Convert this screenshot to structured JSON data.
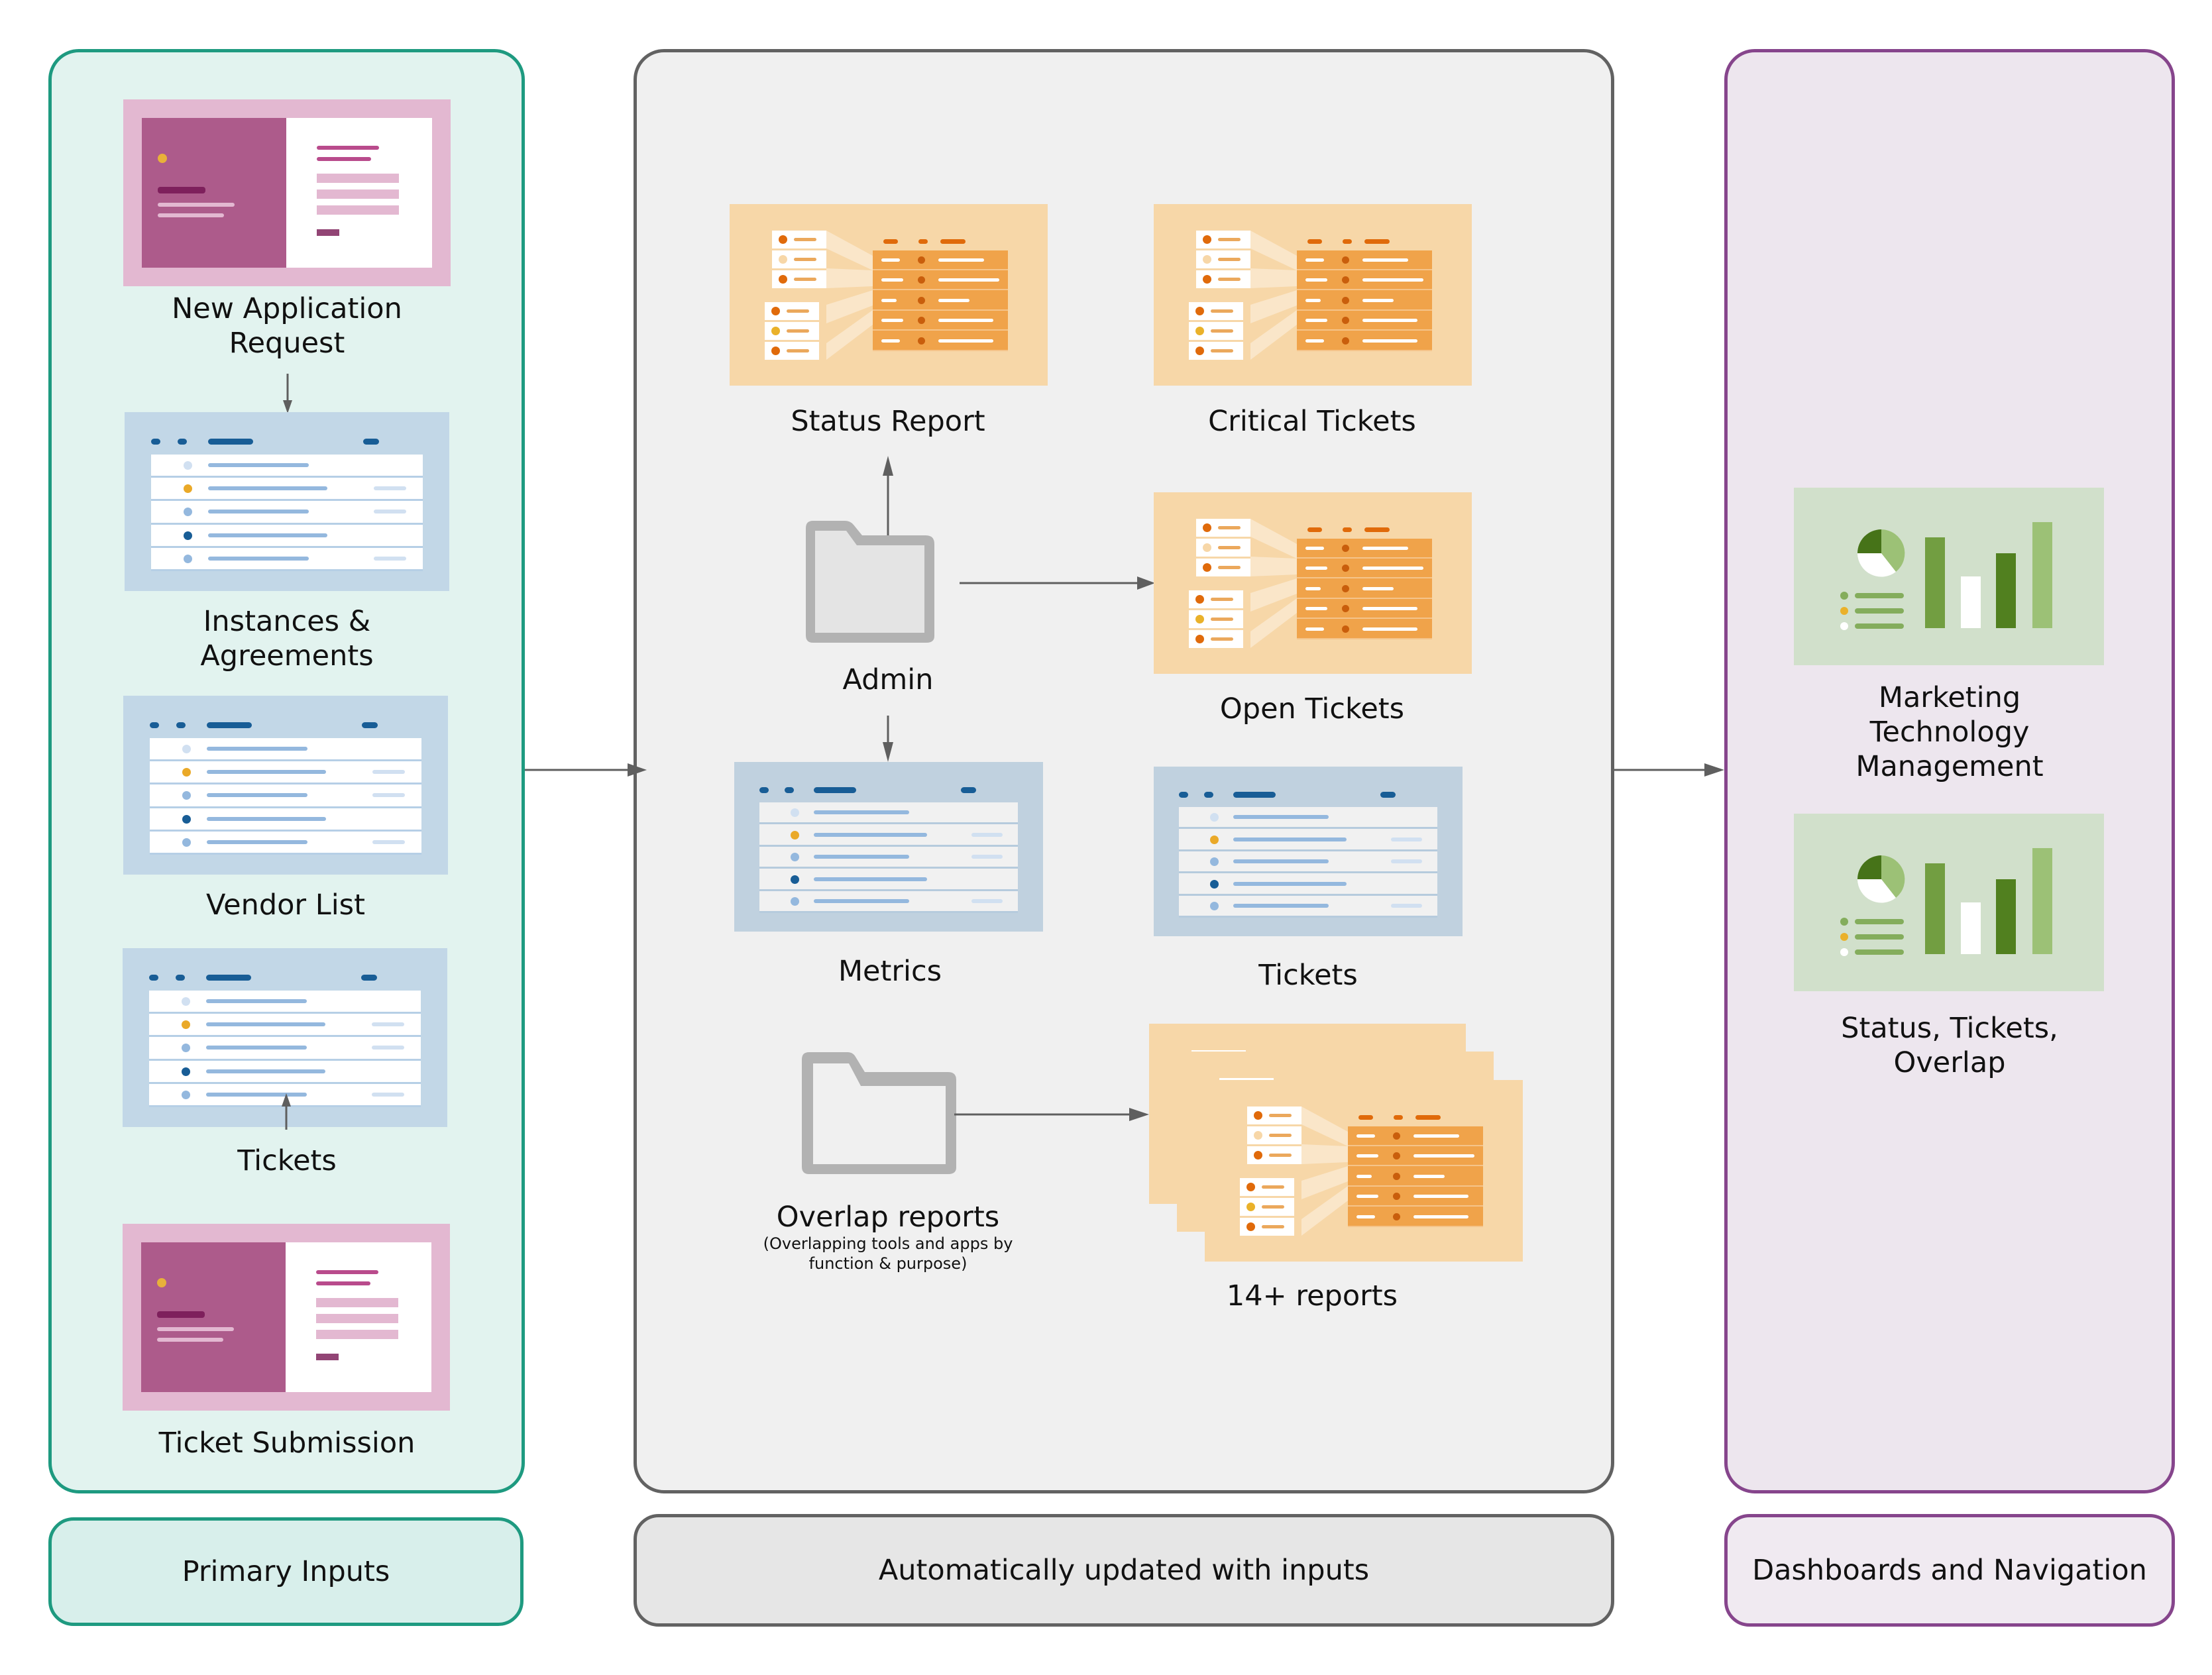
{
  "columns": {
    "primary_inputs": {
      "footer_label": "Primary Inputs",
      "items": [
        {
          "label_lines": [
            "New Application",
            "Request"
          ],
          "icon": "form-icon"
        },
        {
          "label_lines": [
            "Instances &",
            "Agreements"
          ],
          "icon": "table-icon"
        },
        {
          "label_lines": [
            "Vendor List"
          ],
          "icon": "table-icon"
        },
        {
          "label_lines": [
            "Tickets"
          ],
          "icon": "table-icon"
        },
        {
          "label_lines": [
            "Ticket Submission"
          ],
          "icon": "form-icon"
        }
      ]
    },
    "auto_updated": {
      "footer_label": "Automatically updated with inputs",
      "items": {
        "status_report": "Status Report",
        "critical_tickets": "Critical Tickets",
        "admin": "Admin",
        "open_tickets": "Open Tickets",
        "metrics": "Metrics",
        "tickets": "Tickets",
        "overlap_reports": "Overlap reports",
        "overlap_reports_note_1": "(Overlapping tools and apps by",
        "overlap_reports_note_2": "function & purpose)",
        "reports_count": "14+ reports"
      }
    },
    "dashboards": {
      "footer_label": "Dashboards and Navigation",
      "items": [
        {
          "label_lines": [
            "Marketing",
            "Technology",
            "Management"
          ],
          "icon": "dashboard-icon"
        },
        {
          "label_lines": [
            "Status, Tickets,",
            "Overlap"
          ],
          "icon": "dashboard-icon"
        }
      ]
    }
  },
  "colors": {
    "primary_border": "#1e9a80",
    "primary_bg": "#e2f3ef",
    "auto_border": "#626262",
    "auto_bg": "#f0f0f0",
    "dash_border": "#86458c",
    "dash_bg": "#ede6ee",
    "arrow": "#5f5f5f"
  }
}
